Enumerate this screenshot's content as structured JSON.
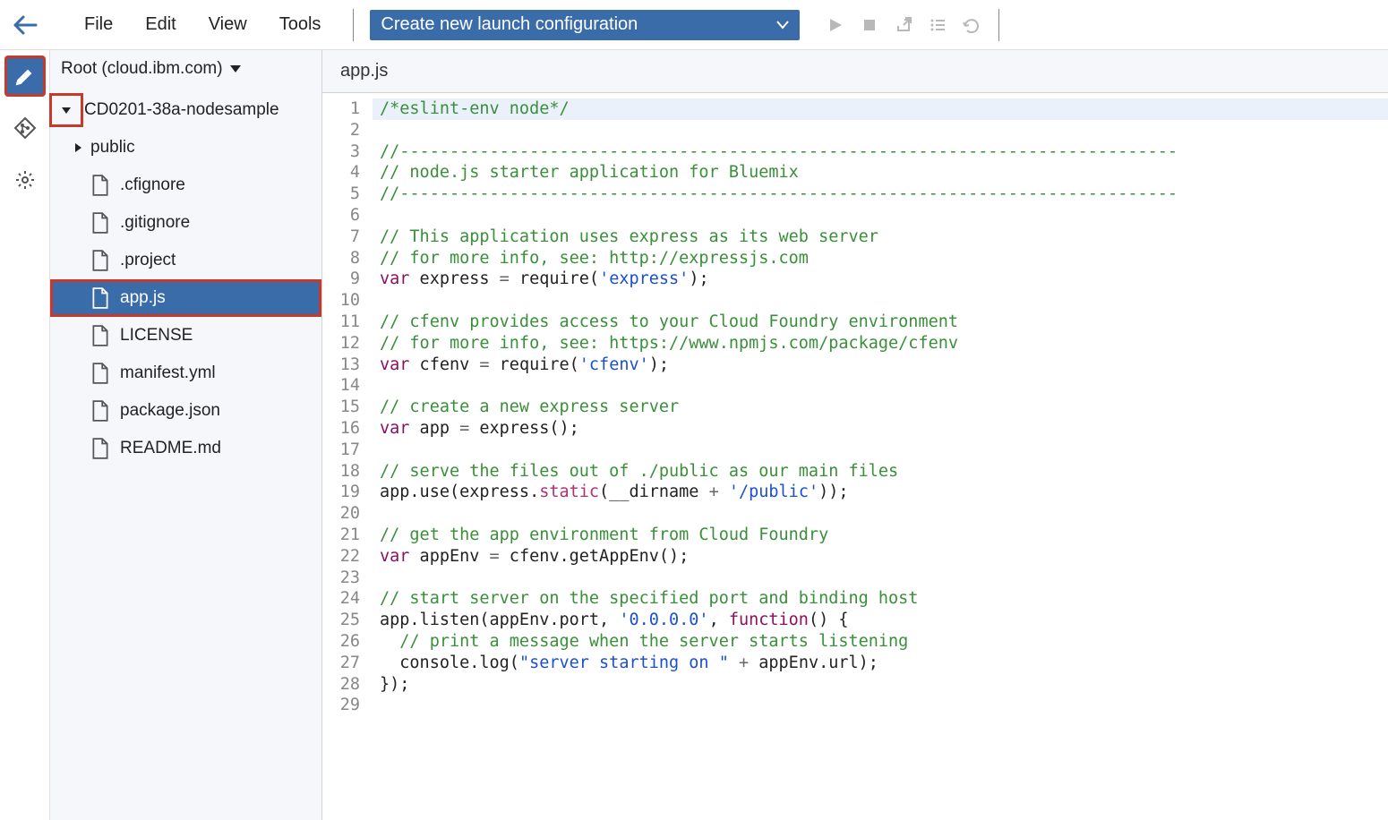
{
  "topbar": {
    "menu": [
      "File",
      "Edit",
      "View",
      "Tools"
    ],
    "launch_label": "Create new launch configuration"
  },
  "sidebar": {
    "root_label": "Root (cloud.ibm.com)",
    "project": "CD0201-38a-nodesample",
    "folder_public": "public",
    "files": [
      ".cfignore",
      ".gitignore",
      ".project",
      "app.js",
      "LICENSE",
      "manifest.yml",
      "package.json",
      "README.md"
    ],
    "selected_file": "app.js"
  },
  "editor": {
    "tab": "app.js",
    "code_lines": [
      {
        "n": 1,
        "type": "hl",
        "segs": [
          {
            "t": "/*eslint-env node*/",
            "c": "c-comment"
          }
        ]
      },
      {
        "n": 2,
        "type": "",
        "segs": []
      },
      {
        "n": 3,
        "type": "",
        "segs": [
          {
            "t": "//------------------------------------------------------------------------------",
            "c": "c-comment"
          }
        ]
      },
      {
        "n": 4,
        "type": "",
        "segs": [
          {
            "t": "// node.js starter application for Bluemix",
            "c": "c-comment"
          }
        ]
      },
      {
        "n": 5,
        "type": "",
        "segs": [
          {
            "t": "//------------------------------------------------------------------------------",
            "c": "c-comment"
          }
        ]
      },
      {
        "n": 6,
        "type": "",
        "segs": []
      },
      {
        "n": 7,
        "type": "",
        "segs": [
          {
            "t": "// This application uses express as its web server",
            "c": "c-comment"
          }
        ]
      },
      {
        "n": 8,
        "type": "",
        "segs": [
          {
            "t": "// for more info, see: http://expressjs.com",
            "c": "c-comment"
          }
        ]
      },
      {
        "n": 9,
        "type": "",
        "segs": [
          {
            "t": "var",
            "c": "c-key"
          },
          {
            "t": " express ",
            "c": ""
          },
          {
            "t": "=",
            "c": "c-op"
          },
          {
            "t": " require(",
            "c": ""
          },
          {
            "t": "'express'",
            "c": "c-str"
          },
          {
            "t": ");",
            "c": ""
          }
        ]
      },
      {
        "n": 10,
        "type": "",
        "segs": []
      },
      {
        "n": 11,
        "type": "",
        "segs": [
          {
            "t": "// cfenv provides access to your Cloud Foundry environment",
            "c": "c-comment"
          }
        ]
      },
      {
        "n": 12,
        "type": "",
        "segs": [
          {
            "t": "// for more info, see: https://www.npmjs.com/package/cfenv",
            "c": "c-comment"
          }
        ]
      },
      {
        "n": 13,
        "type": "",
        "segs": [
          {
            "t": "var",
            "c": "c-key"
          },
          {
            "t": " cfenv ",
            "c": ""
          },
          {
            "t": "=",
            "c": "c-op"
          },
          {
            "t": " require(",
            "c": ""
          },
          {
            "t": "'cfenv'",
            "c": "c-str"
          },
          {
            "t": ");",
            "c": ""
          }
        ]
      },
      {
        "n": 14,
        "type": "",
        "segs": []
      },
      {
        "n": 15,
        "type": "",
        "segs": [
          {
            "t": "// create a new express server",
            "c": "c-comment"
          }
        ]
      },
      {
        "n": 16,
        "type": "",
        "segs": [
          {
            "t": "var",
            "c": "c-key"
          },
          {
            "t": " app ",
            "c": ""
          },
          {
            "t": "=",
            "c": "c-op"
          },
          {
            "t": " express();",
            "c": ""
          }
        ]
      },
      {
        "n": 17,
        "type": "",
        "segs": []
      },
      {
        "n": 18,
        "type": "",
        "segs": [
          {
            "t": "// serve the files out of ./public as our main files",
            "c": "c-comment"
          }
        ]
      },
      {
        "n": 19,
        "type": "",
        "segs": [
          {
            "t": "app.use(express.",
            "c": ""
          },
          {
            "t": "static",
            "c": "c-fn"
          },
          {
            "t": "(__dirname ",
            "c": ""
          },
          {
            "t": "+",
            "c": "c-op"
          },
          {
            "t": " ",
            "c": ""
          },
          {
            "t": "'/public'",
            "c": "c-str"
          },
          {
            "t": "));",
            "c": ""
          }
        ]
      },
      {
        "n": 20,
        "type": "",
        "segs": []
      },
      {
        "n": 21,
        "type": "",
        "segs": [
          {
            "t": "// get the app environment from Cloud Foundry",
            "c": "c-comment"
          }
        ]
      },
      {
        "n": 22,
        "type": "",
        "segs": [
          {
            "t": "var",
            "c": "c-key"
          },
          {
            "t": " appEnv ",
            "c": ""
          },
          {
            "t": "=",
            "c": "c-op"
          },
          {
            "t": " cfenv.getAppEnv();",
            "c": ""
          }
        ]
      },
      {
        "n": 23,
        "type": "",
        "segs": []
      },
      {
        "n": 24,
        "type": "",
        "segs": [
          {
            "t": "// start server on the specified port and binding host",
            "c": "c-comment"
          }
        ]
      },
      {
        "n": 25,
        "type": "",
        "segs": [
          {
            "t": "app.listen(appEnv.port, ",
            "c": ""
          },
          {
            "t": "'0.0.0.0'",
            "c": "c-str"
          },
          {
            "t": ", ",
            "c": ""
          },
          {
            "t": "function",
            "c": "c-key"
          },
          {
            "t": "() {",
            "c": ""
          }
        ]
      },
      {
        "n": 26,
        "type": "",
        "segs": [
          {
            "t": "  ",
            "c": ""
          },
          {
            "t": "// print a message when the server starts listening",
            "c": "c-comment"
          }
        ]
      },
      {
        "n": 27,
        "type": "",
        "segs": [
          {
            "t": "  console.log(",
            "c": ""
          },
          {
            "t": "\"server starting on \"",
            "c": "c-str"
          },
          {
            "t": " ",
            "c": ""
          },
          {
            "t": "+",
            "c": "c-op"
          },
          {
            "t": " appEnv.url);",
            "c": ""
          }
        ]
      },
      {
        "n": 28,
        "type": "",
        "segs": [
          {
            "t": "});",
            "c": ""
          }
        ]
      },
      {
        "n": 29,
        "type": "",
        "segs": []
      }
    ]
  }
}
